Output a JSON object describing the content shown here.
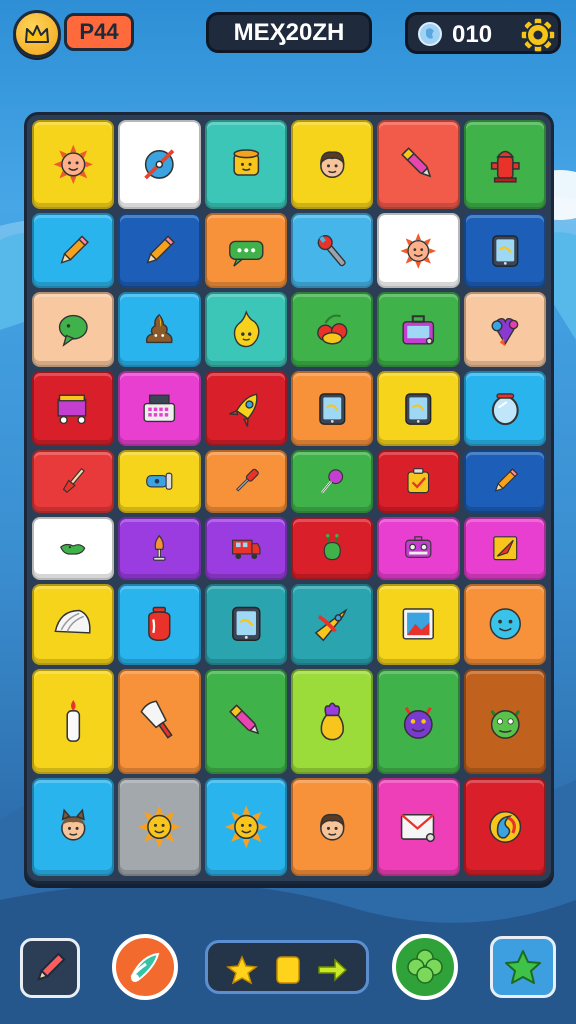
{
  "header": {
    "level_label": "P44",
    "title": "MEӼ20ZH",
    "coins": "010"
  },
  "icons": {
    "crown": "crown-icon",
    "coin": "gem-coin-icon",
    "settings": "gear-icon"
  },
  "board": {
    "rows": [
      [
        {
          "icon": "sun-face",
          "color": "#f6d41c"
        },
        {
          "icon": "compass",
          "color": "#ffffff"
        },
        {
          "icon": "cup-face",
          "color": "#3cc6b8"
        },
        {
          "icon": "boy-face",
          "color": "#f6d41c"
        },
        {
          "icon": "marker",
          "color": "#f25a4a"
        },
        {
          "icon": "fire-hydrant",
          "color": "#3fb24a"
        }
      ],
      [
        {
          "icon": "pencil",
          "color": "#2ab4ee"
        },
        {
          "icon": "pencil",
          "color": "#1d5fb8"
        },
        {
          "icon": "chat-bubble",
          "color": "#f7913a"
        },
        {
          "icon": "wrench",
          "color": "#46b6ea"
        },
        {
          "icon": "sun-face",
          "color": "#ffffff"
        },
        {
          "icon": "tablet",
          "color": "#1d5fb8"
        }
      ],
      [
        {
          "icon": "speech-bubble",
          "color": "#f8c9a0"
        },
        {
          "icon": "poop",
          "color": "#2ab4ee"
        },
        {
          "icon": "flame-face",
          "color": "#3cc6b8"
        },
        {
          "icon": "cherries",
          "color": "#3fb24a"
        },
        {
          "icon": "briefcase",
          "color": "#3fb24a"
        },
        {
          "icon": "heart-bouquet",
          "color": "#f8c9a0"
        }
      ],
      [
        {
          "icon": "cart",
          "color": "#d81f2a"
        },
        {
          "icon": "register",
          "color": "#e83fd0"
        },
        {
          "icon": "rocket",
          "color": "#d81f2a"
        },
        {
          "icon": "tablet",
          "color": "#f7913a"
        },
        {
          "icon": "tablet",
          "color": "#f6d41c"
        },
        {
          "icon": "mirror",
          "color": "#2ab4ee"
        }
      ],
      [
        {
          "icon": "paintbrush",
          "color": "#e83a3a"
        },
        {
          "icon": "flashlight",
          "color": "#f6d41c"
        },
        {
          "icon": "screwdriver",
          "color": "#f7913a"
        },
        {
          "icon": "lollipop",
          "color": "#3fb24a"
        },
        {
          "icon": "checkbox",
          "color": "#d81f2a"
        },
        {
          "icon": "pencil",
          "color": "#1d5fb8"
        }
      ],
      [
        {
          "icon": "green-blob",
          "color": "#ffffff"
        },
        {
          "icon": "lamp",
          "color": "#9a3ce0"
        },
        {
          "icon": "truck",
          "color": "#9a3ce0"
        },
        {
          "icon": "alien-bug",
          "color": "#d81f2a"
        },
        {
          "icon": "radio",
          "color": "#e83fd0"
        },
        {
          "icon": "paper-kite",
          "color": "#e83fd0"
        }
      ],
      [
        {
          "icon": "shell",
          "color": "#f6d41c"
        },
        {
          "icon": "jar",
          "color": "#2ab4ee"
        },
        {
          "icon": "tablet",
          "color": "#2aa5b0"
        },
        {
          "icon": "rocket-fish",
          "color": "#2aa5b0"
        },
        {
          "icon": "picture",
          "color": "#f6d41c"
        },
        {
          "icon": "blue-face",
          "color": "#f7913a"
        }
      ],
      [
        {
          "icon": "candle",
          "color": "#f6d41c"
        },
        {
          "icon": "ice-cream",
          "color": "#f7913a"
        },
        {
          "icon": "marker",
          "color": "#3fb24a"
        },
        {
          "icon": "vase",
          "color": "#9bdc3a"
        },
        {
          "icon": "monster",
          "color": "#3fb24a"
        },
        {
          "icon": "green-monster",
          "color": "#c0621e"
        }
      ],
      [
        {
          "icon": "cat-boy",
          "color": "#2ab4ee"
        },
        {
          "icon": "sun",
          "color": "#a3a8ad"
        },
        {
          "icon": "sun",
          "color": "#2ab4ee"
        },
        {
          "icon": "boy-face",
          "color": "#f7913a"
        },
        {
          "icon": "envelope",
          "color": "#ef3fb8"
        },
        {
          "icon": "swirl-logo",
          "color": "#d81f2a"
        }
      ]
    ]
  },
  "toolbar": {
    "pencil": "pencil-icon",
    "brush": "brush-icon",
    "star": "star-icon",
    "block": "square-icon",
    "arrow": "arrow-right-icon",
    "clover": "clover-icon",
    "favorite": "star-icon"
  }
}
